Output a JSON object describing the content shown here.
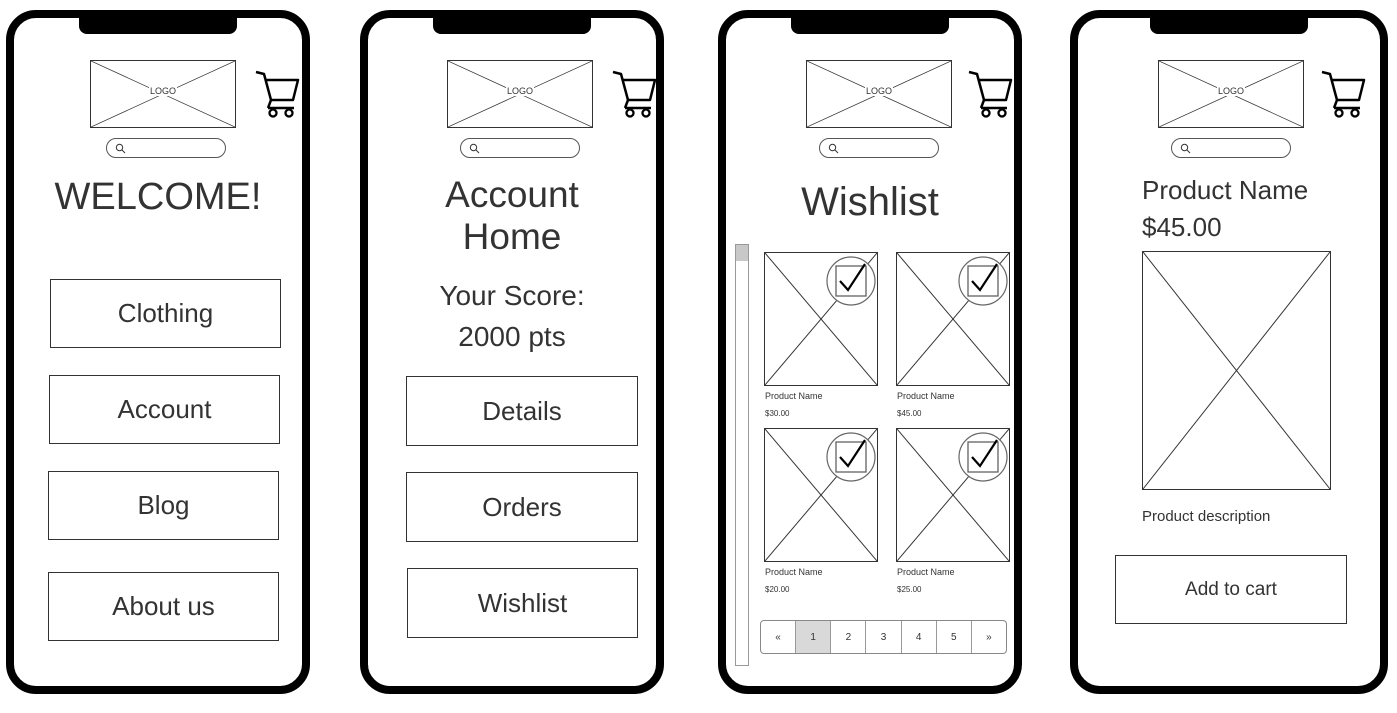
{
  "common": {
    "logo_text": "LOGO"
  },
  "screens": {
    "welcome": {
      "title": "WELCOME!",
      "buttons": [
        "Clothing",
        "Account",
        "Blog",
        "About us"
      ]
    },
    "account": {
      "title_line1": "Account",
      "title_line2": "Home",
      "score_line1": "Your Score:",
      "score_line2": "2000 pts",
      "buttons": [
        "Details",
        "Orders",
        "Wishlist"
      ]
    },
    "wishlist": {
      "title": "Wishlist",
      "items": [
        {
          "name": "Product Name",
          "price": "$30.00",
          "checked": true
        },
        {
          "name": "Product Name",
          "price": "$45.00",
          "checked": true
        },
        {
          "name": "Product Name",
          "price": "$20.00",
          "checked": true
        },
        {
          "name": "Product Name",
          "price": "$25.00",
          "checked": true
        }
      ],
      "pagination": {
        "prev": "«",
        "pages": [
          "1",
          "2",
          "3",
          "4",
          "5"
        ],
        "next": "»",
        "current": "1"
      }
    },
    "product": {
      "name": "Product Name",
      "price": "$45.00",
      "description": "Product description",
      "add_to_cart": "Add to cart"
    }
  }
}
